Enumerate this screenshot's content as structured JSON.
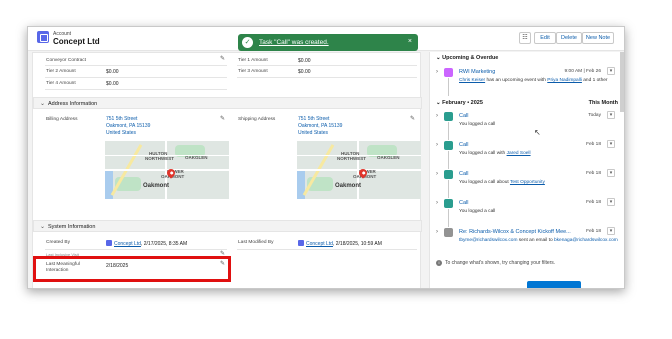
{
  "header": {
    "object_label": "Account",
    "record_name": "Concept Ltd",
    "buttons": [
      "Edit",
      "Delete",
      "New Note"
    ],
    "hierarchy_icon": "hierarchy-icon"
  },
  "toast": {
    "message": "Task \"Call\" was created.",
    "close": "×",
    "check": "✓",
    "color": "#2e844a"
  },
  "top_fields": {
    "conveyor_contract": "Conveyor Contract",
    "tier2_label": "Tier 2 Amount",
    "tier2_value": "$0.00",
    "tier4_label": "Tier 4 Amount",
    "tier4_value": "$0.00",
    "tier1_label": "Tier 1 Amount",
    "tier1_value": "$0.00",
    "tier3_label": "Tier 3 Amount",
    "tier3_value": "$0.00"
  },
  "address": {
    "section_title": "Address Information",
    "billing_label": "Billing Address",
    "billing_line1": "751 5th Street",
    "billing_line2": "Oakmont, PA 15139",
    "billing_line3": "United States",
    "shipping_label": "Shipping Address",
    "shipping_line1": "751 5th Street",
    "shipping_line2": "Oakmont, PA 15139",
    "shipping_line3": "United States",
    "map_labels": {
      "hulton": "HULTON",
      "northwest": "NORTHWEST",
      "oakglen": "OAKGLEN",
      "lower": "LOWER",
      "oakmont": "OAKMONT",
      "town": "Oakmont"
    }
  },
  "system": {
    "section_title": "System Information",
    "created_by_label": "Created By",
    "created_by_user": "Concept Ltd",
    "created_by_date": ", 2/17/2025, 8:35 AM",
    "modified_label": "Last Modified By",
    "modified_user": "Concept Ltd",
    "modified_date": ", 2/18/2025, 10:59 AM",
    "last_review_label": "Last Inclusive Visit",
    "lmi_label_1": "Last Meaningful",
    "lmi_label_2": "Interaction",
    "lmi_value": "2/18/2025"
  },
  "activity": {
    "upcoming_title": "Upcoming & Overdue",
    "upcoming": {
      "title": "RWI Marketing",
      "date": "9:00 AM | Feb 26",
      "user": "Chris Keiser",
      "text": " has an upcoming event with ",
      "contact": "Priya Nadimpalli",
      "more": " and 1 other"
    },
    "month_title": "February • 2025",
    "month_label": "This Month",
    "items": [
      {
        "title": "Call",
        "date": "Today",
        "desc": "You logged a call",
        "link": ""
      },
      {
        "title": "Call",
        "date": "Feb 18",
        "desc": "You logged a call with ",
        "link": "Jared Soell"
      },
      {
        "title": "Call",
        "date": "Feb 18",
        "desc": "You logged a call about ",
        "link": "Test Opportunity"
      },
      {
        "title": "Call",
        "date": "Feb 18",
        "desc": "You logged a call",
        "link": ""
      }
    ],
    "email": {
      "title": "Re: Richards-Wilcox & Concept Kickoff Mee...",
      "date": "Feb 18",
      "from": "tbyme@richardswilcox.com",
      "text": " sent an email to ",
      "to": "bkenaga@richardswilcox.com"
    },
    "filter_note": "To change what's shown, try changing your filters.",
    "colors": {
      "call": "#2a9d8f",
      "event": "#cb65ff",
      "email": "#939393"
    }
  }
}
